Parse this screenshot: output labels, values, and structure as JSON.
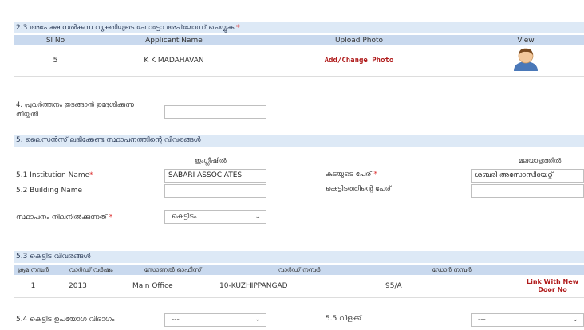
{
  "section_23": {
    "title": "2.3 അപേക്ഷ നൽകുന്ന വ്യക്തിയുടെ ഫോട്ടോ അപ്‌ലോഡ് ചെയ്യുക",
    "required_mark": "*",
    "headers": [
      "Sl No",
      "Applicant Name",
      "Upload Photo",
      "View"
    ],
    "row": {
      "sl_no": "5",
      "applicant_name": "K K MADAHAVAN",
      "upload_link": "Add/Change Photo"
    }
  },
  "field_4": {
    "label_line1": "4. പ്രവർത്തനം തുടങ്ങാൻ ഉദ്ദേശിക്കുന്ന",
    "label_line2": "തിയ്യതി",
    "value": ""
  },
  "section_5": {
    "title": "5. ലൈസൻസ് ലഭിക്കേണ്ട സ്ഥാപനത്തിന്റെ വിവരങ്ങൾ",
    "col_english": "ഇംഗ്ലീഷിൽ",
    "col_malayalam": "മലയാളത്തിൽ",
    "institution_label": "5.1 Institution Name",
    "institution_value": "SABARI ASSOCIATES",
    "building_label": "5.2 Building Name",
    "building_value": "",
    "shop_name_label": "കടയുടെ പേര്",
    "shop_name_value": "ശബരി അസോസിയേറ്റ്",
    "building_name_ml_label": "കെട്ടിടത്തിന്റെ പേര്",
    "building_name_ml_value": "",
    "ownership_label": "സ്ഥാപനം നിലനിൽക്കുന്നത്",
    "ownership_value": "കെട്ടിടം",
    "required_mark": "*"
  },
  "section_53": {
    "title": "5.3 കെട്ടിട വിവരങ്ങൾ",
    "headers": [
      "ക്രമ നമ്പർ",
      "വാർഡ് വർഷം",
      "സോണൽ ഓഫീസ്",
      "വാർഡ് നമ്പർ",
      "ഡോർ നമ്പർ",
      ""
    ],
    "row": {
      "sl": "1",
      "ward_year": "2013",
      "zonal_office": "Main Office",
      "ward_no": "10-KUZHIPPANGAD",
      "door_no": "95/A",
      "link_line1": "Link With New",
      "link_line2": "Door No"
    }
  },
  "field_54": {
    "label": "5.4 കെട്ടിട ഉപയോഗ വിഭാഗം",
    "value": "---"
  },
  "field_55": {
    "label": "5.5 വിളക്ക്",
    "value": "---"
  }
}
